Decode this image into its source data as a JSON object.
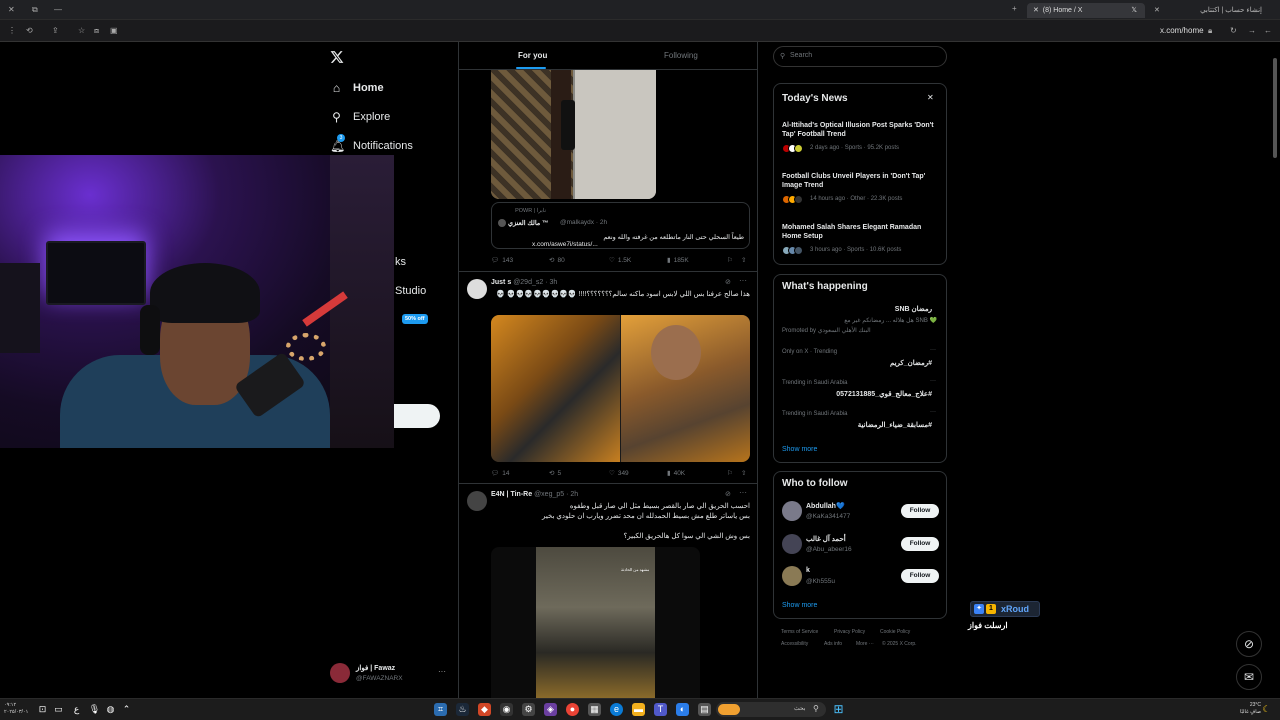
{
  "browser": {
    "tab_active": "(8) Home / X",
    "tab_other": "إنشاء حساب | اكتتابي",
    "url": "x.com/home"
  },
  "nav": {
    "home": "Home",
    "explore": "Explore",
    "notifications": "Notifications",
    "bookmarks_partial": "ks",
    "studio_partial": "Studio",
    "promo_badge": "50% off",
    "notif_count": "3"
  },
  "profile": {
    "name": "فواز | Fawaz",
    "handle": "@FAWAZNARX"
  },
  "timeline_tabs": {
    "for_you": "For you",
    "following": "Following"
  },
  "tweets": [
    {
      "quote_label": "نابرا | POWR",
      "quote_name": "مالك العنزي ™",
      "quote_handle": "@malkaydx · 2h",
      "quote_text": "طيعاً السحلي حتى النار ماتطلعه من غرفته والله ونعم",
      "quote_link": "x.com/aswe7i/status/...",
      "replies": "143",
      "reposts": "80",
      "likes": "1.5K",
      "views": "185K"
    },
    {
      "name": "Just s",
      "meta": "@29d_s2 · 3h",
      "text": "هذا صالح عرفنا بس اللي لابس اسود ماكنه سالم؟؟؟؟؟؟؟!!!! 💀💀💀💀💀💀💀💀 💀",
      "replies": "14",
      "reposts": "5",
      "likes": "349",
      "views": "40K"
    },
    {
      "name": "E4N | Tin-Re",
      "meta": "@xeg_p5 · 2h",
      "text1": "احسب الحريق الي صار بالقصر بسيط مثل الي صار قبل وطفوه",
      "text2": "بس ياساتر طلع مش بسيط الحمدلله ان محد تضرر ويارب ان حلودي بخير",
      "text3": "بس وش الشي الي سوا كل هالحريق الكبير؟",
      "video_caption": "مشهد من الحادثة"
    }
  ],
  "search_placeholder": "Search",
  "todays_news": {
    "title": "Today's News",
    "items": [
      {
        "headline": "Al-Ittihad's Optical Illusion Post Sparks 'Don't Tap' Football Trend",
        "meta": "2 days ago · Sports · 95.2K posts"
      },
      {
        "headline": "Football Clubs Unveil Players in 'Don't Tap' Image Trend",
        "meta": "14 hours ago · Other · 22.3K posts"
      },
      {
        "headline": "Mohamed Salah Shares Elegant Ramadan Home Setup",
        "meta": "3 hours ago · Sports · 10.6K posts"
      }
    ]
  },
  "whats_happening": {
    "title": "What's happening",
    "promo_title": "رمضان SNB",
    "promo_sub": "💚 SNB هل هلاله ... رمضانكم غير مع",
    "promo_by": "Promoted by البنك الأهلي السعودي",
    "trends": [
      {
        "context": "Only on X · Trending",
        "topic": "#رمضان_كريم"
      },
      {
        "context": "Trending in Saudi Arabia",
        "topic": "#علاج_معالج_قوي_0572131885"
      },
      {
        "context": "Trending in Saudi Arabia",
        "topic": "#مسابقة_ضياء_الرمضانية"
      }
    ],
    "show_more": "Show more"
  },
  "who_to_follow": {
    "title": "Who to follow",
    "users": [
      {
        "name": "Abdullah💙",
        "handle": "@KaKa341477",
        "button": "Follow"
      },
      {
        "name": "أحمد آل غالب",
        "handle": "@Abu_abeer16",
        "button": "Follow"
      },
      {
        "name": "k",
        "handle": "@Kh555u",
        "button": "Follow"
      }
    ],
    "show_more": "Show more"
  },
  "footer": [
    "Terms of Service",
    "Privacy Policy",
    "Cookie Policy",
    "Accessibility",
    "Ads info",
    "More ···",
    "© 2025 X Corp."
  ],
  "overlay": {
    "brand": "xRoud",
    "rank": "1",
    "caption": "ارسلت فواز"
  },
  "taskbar": {
    "search": "بحث",
    "temp": "23°C",
    "weather": "صافٍ غالبًا",
    "time": "٠٩:١٢",
    "date": "٢٠٢٥/٠٣/٠١"
  },
  "colors": {
    "accent": "#1d9bf0",
    "bg": "#000000",
    "border": "#2f3336",
    "muted": "#71767b"
  }
}
